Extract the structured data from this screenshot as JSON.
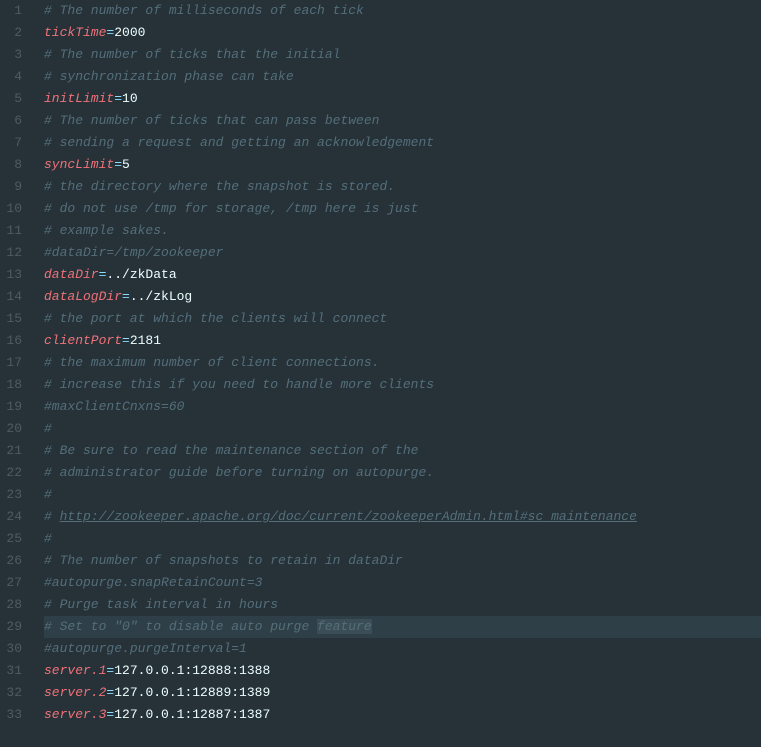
{
  "lines": [
    {
      "n": 1,
      "segs": [
        {
          "c": "comment",
          "t": "# The number of milliseconds of each tick"
        }
      ]
    },
    {
      "n": 2,
      "segs": [
        {
          "c": "key",
          "t": "tickTime"
        },
        {
          "c": "eq",
          "t": "="
        },
        {
          "c": "val",
          "t": "2000"
        }
      ]
    },
    {
      "n": 3,
      "segs": [
        {
          "c": "comment",
          "t": "# The number of ticks that the initial "
        }
      ]
    },
    {
      "n": 4,
      "segs": [
        {
          "c": "comment",
          "t": "# synchronization phase can take"
        }
      ]
    },
    {
      "n": 5,
      "segs": [
        {
          "c": "key",
          "t": "initLimit"
        },
        {
          "c": "eq",
          "t": "="
        },
        {
          "c": "val",
          "t": "10"
        }
      ]
    },
    {
      "n": 6,
      "segs": [
        {
          "c": "comment",
          "t": "# The number of ticks that can pass between "
        }
      ]
    },
    {
      "n": 7,
      "segs": [
        {
          "c": "comment",
          "t": "# sending a request and getting an acknowledgement"
        }
      ]
    },
    {
      "n": 8,
      "segs": [
        {
          "c": "key",
          "t": "syncLimit"
        },
        {
          "c": "eq",
          "t": "="
        },
        {
          "c": "val",
          "t": "5"
        }
      ]
    },
    {
      "n": 9,
      "segs": [
        {
          "c": "comment",
          "t": "# the directory where the snapshot is stored."
        }
      ]
    },
    {
      "n": 10,
      "segs": [
        {
          "c": "comment",
          "t": "# do not use /tmp for storage, /tmp here is just "
        }
      ]
    },
    {
      "n": 11,
      "segs": [
        {
          "c": "comment",
          "t": "# example sakes."
        }
      ]
    },
    {
      "n": 12,
      "segs": [
        {
          "c": "comment",
          "t": "#dataDir=/tmp/zookeeper"
        }
      ]
    },
    {
      "n": 13,
      "segs": [
        {
          "c": "key",
          "t": "dataDir"
        },
        {
          "c": "eq",
          "t": "="
        },
        {
          "c": "val",
          "t": "../zkData"
        }
      ]
    },
    {
      "n": 14,
      "segs": [
        {
          "c": "key",
          "t": "dataLogDir"
        },
        {
          "c": "eq",
          "t": "="
        },
        {
          "c": "val",
          "t": "../zkLog"
        }
      ]
    },
    {
      "n": 15,
      "segs": [
        {
          "c": "comment",
          "t": "# the port at which the clients will connect"
        }
      ]
    },
    {
      "n": 16,
      "segs": [
        {
          "c": "key",
          "t": "clientPort"
        },
        {
          "c": "eq",
          "t": "="
        },
        {
          "c": "val",
          "t": "2181"
        }
      ]
    },
    {
      "n": 17,
      "segs": [
        {
          "c": "comment",
          "t": "# the maximum number of client connections."
        }
      ]
    },
    {
      "n": 18,
      "segs": [
        {
          "c": "comment",
          "t": "# increase this if you need to handle more clients"
        }
      ]
    },
    {
      "n": 19,
      "segs": [
        {
          "c": "comment",
          "t": "#maxClientCnxns=60"
        }
      ]
    },
    {
      "n": 20,
      "segs": [
        {
          "c": "comment",
          "t": "#"
        }
      ]
    },
    {
      "n": 21,
      "segs": [
        {
          "c": "comment",
          "t": "# Be sure to read the maintenance section of the "
        }
      ]
    },
    {
      "n": 22,
      "segs": [
        {
          "c": "comment",
          "t": "# administrator guide before turning on autopurge."
        }
      ]
    },
    {
      "n": 23,
      "segs": [
        {
          "c": "comment",
          "t": "#"
        }
      ]
    },
    {
      "n": 24,
      "segs": [
        {
          "c": "comment",
          "t": "# "
        },
        {
          "c": "link",
          "t": "http://zookeeper.apache.org/doc/current/zookeeperAdmin.html#sc_maintenance"
        }
      ]
    },
    {
      "n": 25,
      "segs": [
        {
          "c": "comment",
          "t": "#"
        }
      ]
    },
    {
      "n": 26,
      "segs": [
        {
          "c": "comment",
          "t": "# The number of snapshots to retain in dataDir"
        }
      ]
    },
    {
      "n": 27,
      "segs": [
        {
          "c": "comment",
          "t": "#autopurge.snapRetainCount=3"
        }
      ]
    },
    {
      "n": 28,
      "segs": [
        {
          "c": "comment",
          "t": "# Purge task interval in hours"
        }
      ]
    },
    {
      "n": 29,
      "hl": true,
      "segs": [
        {
          "c": "comment",
          "t": "# Set to \"0\" to disable auto purge "
        },
        {
          "c": "comment sel",
          "t": "feature"
        }
      ]
    },
    {
      "n": 30,
      "segs": [
        {
          "c": "comment",
          "t": "#autopurge.purgeInterval=1"
        }
      ]
    },
    {
      "n": 31,
      "segs": [
        {
          "c": "key",
          "t": "server.1"
        },
        {
          "c": "eq",
          "t": "="
        },
        {
          "c": "val",
          "t": "127.0.0.1:12888:1388"
        }
      ]
    },
    {
      "n": 32,
      "segs": [
        {
          "c": "key",
          "t": "server.2"
        },
        {
          "c": "eq",
          "t": "="
        },
        {
          "c": "val",
          "t": "127.0.0.1:12889:1389"
        }
      ]
    },
    {
      "n": 33,
      "segs": [
        {
          "c": "key",
          "t": "server.3"
        },
        {
          "c": "eq",
          "t": "="
        },
        {
          "c": "val",
          "t": "127.0.0.1:12887:1387"
        }
      ]
    }
  ]
}
